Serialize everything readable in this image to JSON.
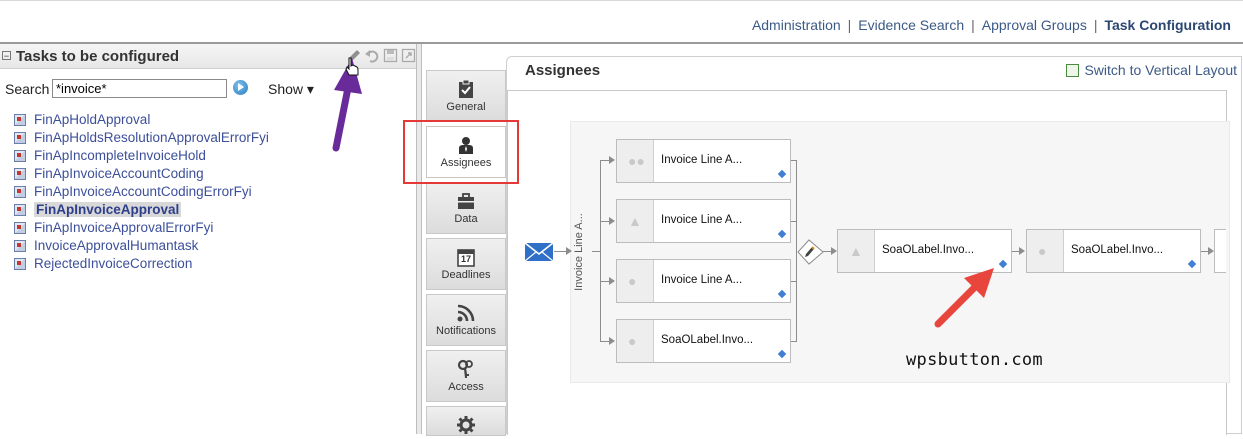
{
  "top_nav": {
    "links": [
      "Administration",
      "Evidence Search",
      "Approval Groups",
      "Task Configuration"
    ],
    "active": "Task Configuration",
    "separator": "|"
  },
  "left_panel": {
    "title": "Tasks to be configured",
    "collapse_glyph": "−",
    "toolbar_icons": [
      "pencil-icon",
      "undo-icon",
      "save-icon",
      "export-icon"
    ],
    "search": {
      "label": "Search",
      "value": "*invoice*"
    },
    "show_menu": "Show ▾",
    "tasks": [
      "FinApHoldApproval",
      "FinApHoldsResolutionApprovalErrorFyi",
      "FinApIncompleteInvoiceHold",
      "FinApInvoiceAccountCoding",
      "FinApInvoiceAccountCodingErrorFyi",
      "FinApInvoiceApproval",
      "FinApInvoiceApprovalErrorFyi",
      "InvoiceApprovalHumantask",
      "RejectedInvoiceCorrection"
    ],
    "selected_task_index": 5
  },
  "tabs": [
    {
      "label": "General",
      "icon": "clipboard-check-icon"
    },
    {
      "label": "Assignees",
      "icon": "person-icon"
    },
    {
      "label": "Data",
      "icon": "briefcase-icon"
    },
    {
      "label": "Deadlines",
      "icon": "calendar-icon",
      "calendar_day": "17"
    },
    {
      "label": "Notifications",
      "icon": "rss-icon"
    },
    {
      "label": "Access",
      "icon": "keys-icon"
    },
    {
      "label": "",
      "icon": "gear-icon"
    }
  ],
  "active_tab": "Assignees",
  "content": {
    "title": "Assignees",
    "switch_layout": "Switch to Vertical Layout",
    "stage_label": "Invoice Line A...",
    "parallel_nodes": [
      "Invoice Line A...",
      "Invoice Line A...",
      "Invoice Line A...",
      "SoaOLabel.Invo..."
    ],
    "serial_nodes": [
      "SoaOLabel.Invo...",
      "SoaOLabel.Invo..."
    ]
  },
  "watermark": "wpsbutton.com",
  "colors": {
    "nav_link": "#3c5a86",
    "task_link": "#3c4f9a",
    "highlight_box": "#e53935",
    "annotation_purple": "#6a2b9a",
    "annotation_red": "#e8453c",
    "diamond": "#3f7fd4",
    "mail_icon": "#2f6fc8"
  }
}
